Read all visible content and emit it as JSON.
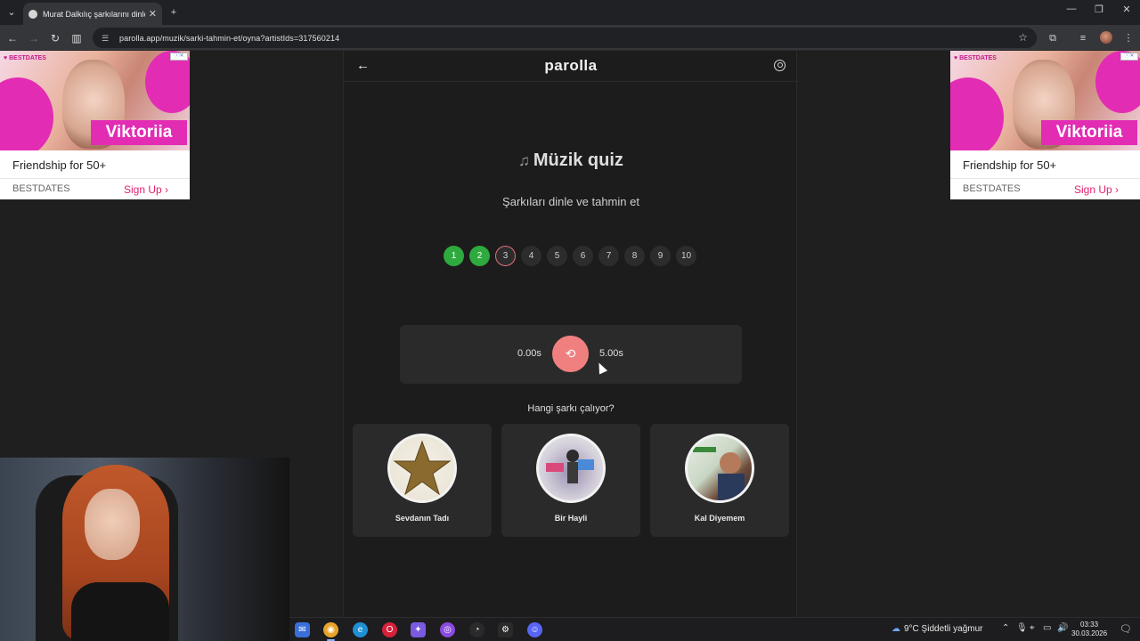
{
  "browser": {
    "tab_title": "Murat Dalkılıç şarkılarını dinle ve tahmin et",
    "url": "parolla.app/muzik/sarki-tahmin-et/oyna?artistIds=317560214"
  },
  "app": {
    "brand": "parolla",
    "quiz_title": "Müzik quiz",
    "subtitle": "Şarkıları dinle ve tahmin et",
    "steps": [
      {
        "n": "1",
        "state": "done"
      },
      {
        "n": "2",
        "state": "done"
      },
      {
        "n": "3",
        "state": "active"
      },
      {
        "n": "4",
        "state": "pending"
      },
      {
        "n": "5",
        "state": "pending"
      },
      {
        "n": "6",
        "state": "pending"
      },
      {
        "n": "7",
        "state": "pending"
      },
      {
        "n": "8",
        "state": "pending"
      },
      {
        "n": "9",
        "state": "pending"
      },
      {
        "n": "10",
        "state": "pending"
      }
    ],
    "player": {
      "time_start": "0.00s",
      "time_end": "5.00s"
    },
    "question": "Hangi şarkı çalıyor?",
    "options": [
      {
        "title": "Sevdanın Tadı"
      },
      {
        "title": "Bir Hayli"
      },
      {
        "title": "Kal Diyemem"
      }
    ]
  },
  "ads": [
    {
      "brand_tag": "♥ BESTDATES",
      "name": "Viktoriia",
      "headline": "Friendship for 50+",
      "brand": "BESTDATES",
      "cta": "Sign Up"
    },
    {
      "brand_tag": "♥ BESTDATES",
      "name": "Viktoriia",
      "headline": "Friendship for 50+",
      "brand": "BESTDATES",
      "cta": "Sign Up"
    }
  ],
  "taskbar": {
    "weather": "9°C  Şiddetli yağmur",
    "time": "03:33",
    "date": "30.03.2026"
  },
  "colors": {
    "accent_green": "#2eaa3e",
    "play_button": "#f08080",
    "ad_pink": "#e32cb4"
  }
}
